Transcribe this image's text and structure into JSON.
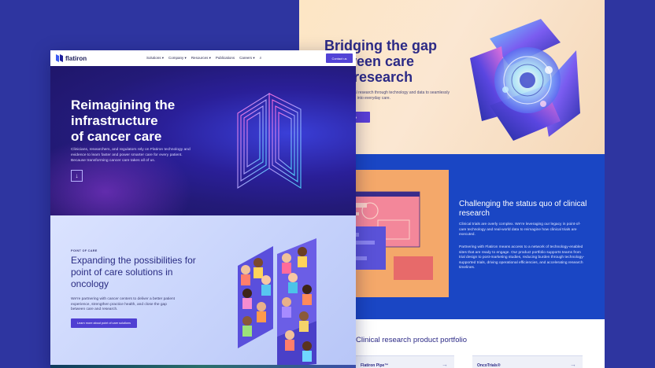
{
  "back": {
    "hero": {
      "title_lines": [
        "Bridging the gap",
        "between care",
        "and research"
      ],
      "desc": "Connecting clinical research through technology and data to seamlessly integrate research into everyday care.",
      "button": "Learn more"
    },
    "challenge": {
      "title": "Challenging the status quo of clinical research",
      "p1": "Clinical trials are overly complex. We're leveraging our legacy in point-of-care technology and real-world data to reimagine how clinical trials are executed.",
      "p2": "Partnering with Flatiron means access to a network of technology-enabled sites that are ready to engage. Our product portfolio supports teams from trial design to post-marketing studies, reducing burden through technology-supported trials, driving operational efficiencies, and accelerating research timelines."
    },
    "portfolio": {
      "title": "Clinical research product portfolio",
      "cards": [
        {
          "label": "Flatiron Pipe™",
          "arrow": "→"
        },
        {
          "label": "OncoTrials®",
          "arrow": "→"
        }
      ]
    }
  },
  "front": {
    "nav": {
      "logo_text": "flatiron",
      "items": [
        "Solutions ▾",
        "Company ▾",
        "Resources ▾",
        "Publications",
        "Careers ▾"
      ],
      "search_icon": "⌕",
      "cta": "Contact us"
    },
    "hero": {
      "title_lines": [
        "Reimagining the",
        "infrastructure",
        "of cancer care"
      ],
      "desc": "Clinicians, researchers, and regulators rely on Flatiron technology and evidence to learn faster and power smarter care for every patient. Because transforming cancer care takes all of us.",
      "arrow": "↓"
    },
    "poc": {
      "eyebrow": "POINT OF CARE",
      "title": "Expanding the possibilities for point of care solutions in oncology",
      "desc": "We're partnering with cancer centers to deliver a better patient experience, strengthen practice health, and close the gap between care and research.",
      "button": "Learn more about point of care solutions"
    }
  },
  "colors": {
    "background": "#2e35a0",
    "accent": "#5243d6",
    "hero_dark": "#231a78",
    "challenge_blue": "#1a46c4",
    "peach": "#fde6c4"
  }
}
